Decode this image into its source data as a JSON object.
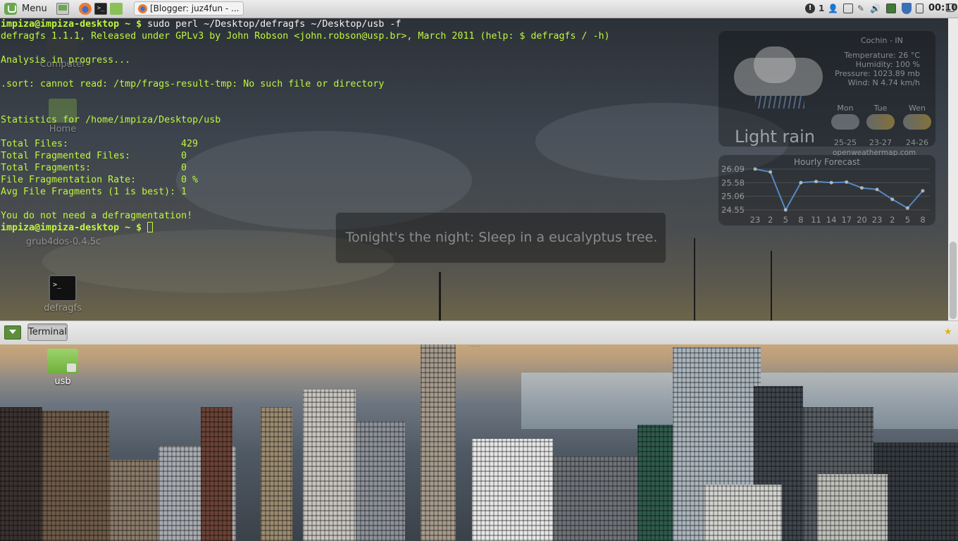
{
  "top_panel": {
    "menu_label": "Menu",
    "terminal_launcher_glyph": ">_",
    "window_button": "[Blogger: juz4fun - ...",
    "tray": {
      "alert_glyph": "!",
      "count": "1",
      "user_glyph": "👤",
      "volume_glyph": "🔊",
      "clock": "00:10"
    }
  },
  "terminal": {
    "prompt": "impiza@impiza-desktop ~ $",
    "command": "sudo perl ~/Desktop/defragfs ~/Desktop/usb -f",
    "lines": {
      "banner": "defragfs 1.1.1, Released under GPLv3 by John Robson <john.robson@usp.br>, March 2011 (help: $ defragfs / -h)",
      "analysis": "Analysis in progress...",
      "sort_error": ".sort: cannot read: /tmp/frags-result-tmp: No such file or directory",
      "statistics": "Statistics for /home/impiza/Desktop/usb",
      "total_files_label": "Total Files:",
      "total_files_value": "429",
      "fragmented_files_label": "Total Fragmented Files:",
      "fragmented_files_value": "0",
      "total_fragments_label": "Total Fragments:",
      "total_fragments_value": "0",
      "frag_rate_label": "File Fragmentation Rate:",
      "frag_rate_value": "0 %",
      "avg_fragments_label": "Avg File Fragments (1 is best):",
      "avg_fragments_value": "1",
      "conclusion": "You do not need a defragmentation!"
    }
  },
  "desktop_icons": {
    "computer": "Computer",
    "home": "Home",
    "grub4dos": "grub4dos-0.4.5c",
    "defragfs": "defragfs",
    "defragfs_glyph": ">_",
    "usb": "usb"
  },
  "weather": {
    "location": "Cochin - IN",
    "temperature": "Temperature: 26 °C",
    "humidity": "Humidity: 100 %",
    "pressure": "Pressure: 1023.89 mb",
    "wind": "Wind: N 4.74 km/h",
    "condition": "Light rain",
    "days": [
      {
        "name": "Mon",
        "range": "25-25"
      },
      {
        "name": "Tue",
        "range": "23-27"
      },
      {
        "name": "Wen",
        "range": "24-26"
      }
    ],
    "source": "openweathermap.com"
  },
  "hourly_forecast": {
    "title": "Hourly Forecast",
    "chart_data": {
      "type": "line",
      "title": "Hourly Forecast",
      "x": [
        "23",
        "2",
        "5",
        "8",
        "11",
        "14",
        "17",
        "20",
        "23",
        "2",
        "5",
        "8"
      ],
      "series": [
        {
          "values": [
            26.09,
            25.98,
            24.55,
            25.58,
            25.62,
            25.58,
            25.6,
            25.38,
            25.32,
            24.95,
            24.62,
            25.27
          ]
        }
      ],
      "yticks": [
        "26.09",
        "25.58",
        "25.06",
        "24.55"
      ],
      "ylim": [
        24.55,
        26.09
      ],
      "grid": true
    }
  },
  "notification": {
    "text": "Tonight's the night: Sleep in a eucalyptus tree."
  },
  "bottom_panel": {
    "task_label": "Terminal",
    "grip": "....",
    "star_glyph": "★"
  },
  "colors": {
    "terminal_green": "#bff73c",
    "mint_green": "#6aa84f"
  }
}
